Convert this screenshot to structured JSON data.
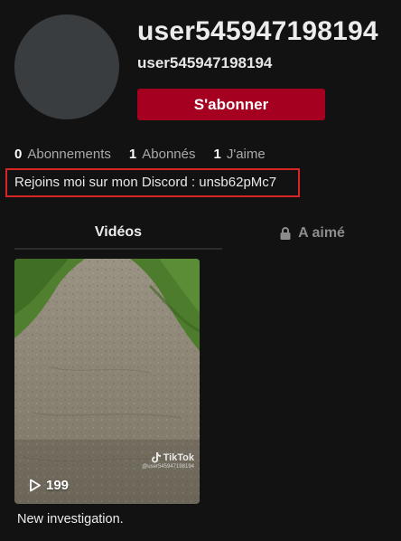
{
  "profile": {
    "username": "user545947198194",
    "nickname": "user545947198194",
    "follow_label": "S'abonner",
    "bio": "Rejoins moi sur mon Discord : unsb62pMc7"
  },
  "stats": [
    {
      "value": "0",
      "label": "Abonnements"
    },
    {
      "value": "1",
      "label": "Abonnés"
    },
    {
      "value": "1",
      "label": "J'aime"
    }
  ],
  "tabs": {
    "videos": "Vidéos",
    "liked": "A aimé"
  },
  "videos": [
    {
      "views": "199",
      "caption": "New investigation.",
      "watermark_brand": "TikTok",
      "watermark_handle": "@user545947198194"
    }
  ],
  "icons": {
    "lock": "lock-icon",
    "play": "play-icon",
    "tiktok_note": "tiktok-note-icon"
  },
  "colors": {
    "background": "#121212",
    "follow_button": "#a5001f",
    "bio_highlight_border": "#d52525",
    "muted_text": "#a9a9a9"
  }
}
